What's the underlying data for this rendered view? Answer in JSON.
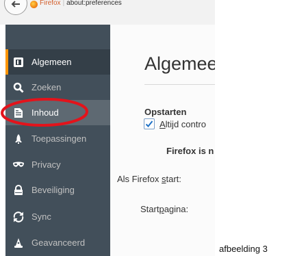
{
  "browser": {
    "url_brand": "Firefox",
    "url_path": "about:preferences"
  },
  "sidebar": {
    "items": [
      {
        "label": "Algemeen",
        "icon": "general-icon"
      },
      {
        "label": "Zoeken",
        "icon": "search-icon"
      },
      {
        "label": "Inhoud",
        "icon": "document-icon"
      },
      {
        "label": "Toepassingen",
        "icon": "rocket-icon"
      },
      {
        "label": "Privacy",
        "icon": "mask-icon"
      },
      {
        "label": "Beveiliging",
        "icon": "lock-icon"
      },
      {
        "label": "Sync",
        "icon": "sync-icon"
      },
      {
        "label": "Geavanceerd",
        "icon": "wizard-icon"
      }
    ],
    "selected": "Algemeen",
    "highlighted": "Inhoud"
  },
  "content": {
    "heading": "Algemee",
    "section_title": "Opstarten",
    "checkbox_label_pre": "",
    "checkbox_label_u": "A",
    "checkbox_label_post": "ltijd contro",
    "checkbox_checked": true,
    "bold_note": "Firefox is n",
    "start_label_pre": "Als Firefox ",
    "start_label_u": "s",
    "start_label_post": "tart:",
    "homepage_label_pre": "Start",
    "homepage_label_u": "p",
    "homepage_label_post": "agina:"
  },
  "annotation_color": "#e3131b",
  "caption": "afbeelding 3"
}
